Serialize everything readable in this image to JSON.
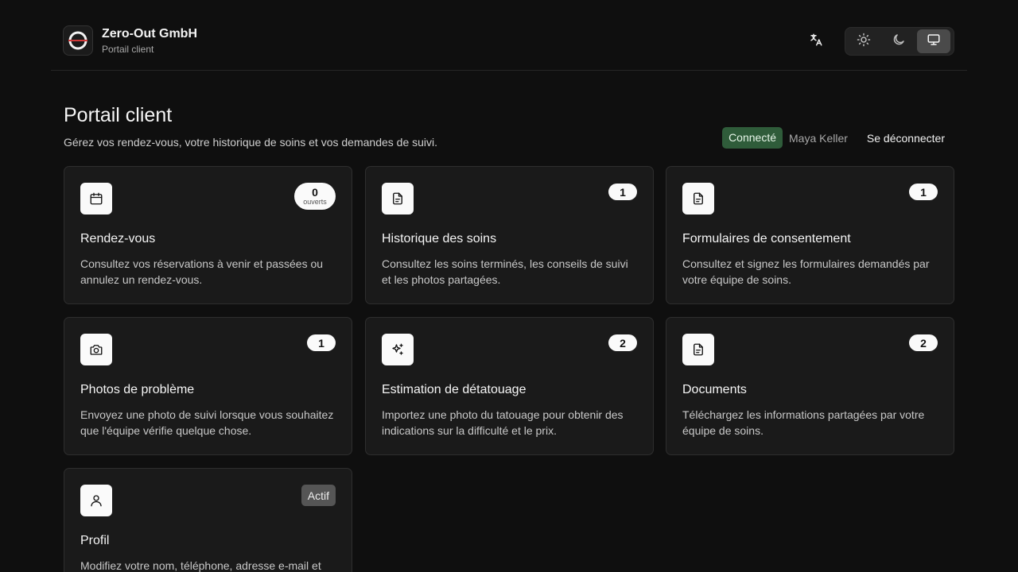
{
  "header": {
    "brand_name": "Zero-Out GmbH",
    "brand_subtitle": "Portail client"
  },
  "page": {
    "title": "Portail client",
    "description": "Gérez vos rendez-vous, votre historique de soins et vos demandes de suivi."
  },
  "session": {
    "status": "Connecté",
    "user": "Maya Keller",
    "logout_label": "Se déconnecter"
  },
  "cards": [
    {
      "title": "Rendez-vous",
      "description": "Consultez vos réservations à venir et passées ou annulez un rendez-vous.",
      "badge": "0",
      "badge_sub": "ouverts",
      "icon": "calendar-icon"
    },
    {
      "title": "Historique des soins",
      "description": "Consultez les soins terminés, les conseils de suivi et les photos partagées.",
      "badge": "1",
      "icon": "file-icon"
    },
    {
      "title": "Formulaires de consentement",
      "description": "Consultez et signez les formulaires demandés par votre équipe de soins.",
      "badge": "1",
      "icon": "file-icon"
    },
    {
      "title": "Photos de problème",
      "description": "Envoyez une photo de suivi lorsque vous souhaitez que l'équipe vérifie quelque chose.",
      "badge": "1",
      "icon": "camera-icon"
    },
    {
      "title": "Estimation de détatouage",
      "description": "Importez une photo du tatouage pour obtenir des indications sur la difficulté et le prix.",
      "badge": "2",
      "icon": "sparkles-icon"
    },
    {
      "title": "Documents",
      "description": "Téléchargez les informations partagées par votre équipe de soins.",
      "badge": "2",
      "icon": "file-icon"
    },
    {
      "title": "Profil",
      "description": "Modifiez votre nom, téléphone, adresse e-mail et",
      "badge": "Actif",
      "icon": "user-icon"
    }
  ],
  "colors": {
    "background": "#0f0f0f",
    "card": "#1a1a1a",
    "connected": "#2f5c3a"
  }
}
